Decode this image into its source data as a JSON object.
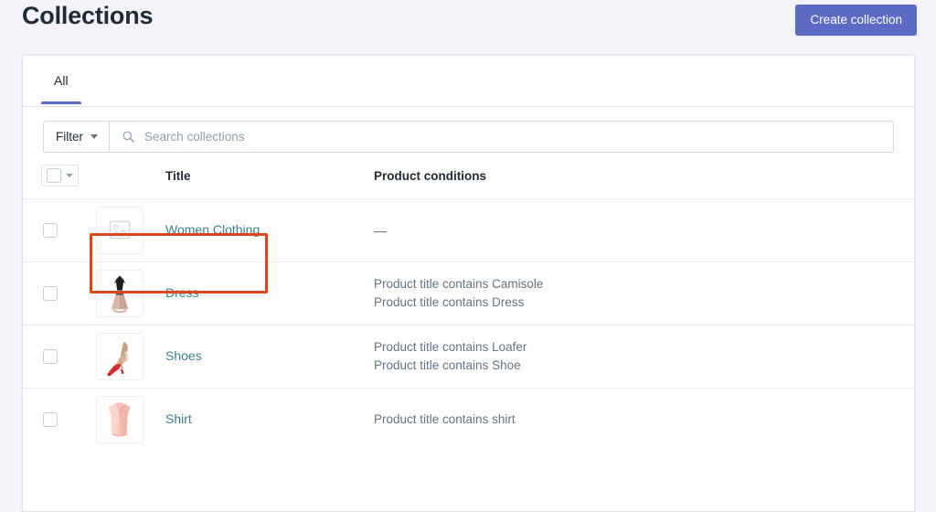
{
  "header": {
    "title": "Collections",
    "create_button_label": "Create collection"
  },
  "card": {
    "tabs": [
      {
        "label": "All",
        "active": true
      }
    ],
    "filter": {
      "button_label": "Filter",
      "caret_icon": "chevron-down-icon"
    },
    "search": {
      "placeholder": "Search collections",
      "value": "",
      "icon": "search-icon"
    },
    "table": {
      "columns": {
        "select": "",
        "thumb": "",
        "title": "Title",
        "conditions": "Product conditions"
      },
      "bulk_select": {
        "checkbox_checked": false,
        "caret_icon": "chevron-down-icon"
      },
      "rows": [
        {
          "title": "Women Clothing",
          "thumb": "image-placeholder-icon",
          "conditions": [
            "—"
          ],
          "highlighted": true
        },
        {
          "title": "Dress",
          "thumb": "dress-thumbnail",
          "conditions": [
            "Product title contains Camisole",
            "Product title contains Dress"
          ],
          "highlighted": false
        },
        {
          "title": "Shoes",
          "thumb": "shoe-thumbnail",
          "conditions": [
            "Product title contains Loafer",
            "Product title contains Shoe"
          ],
          "highlighted": false
        },
        {
          "title": "Shirt",
          "thumb": "shirt-thumbnail",
          "conditions": [
            "Product title contains shirt"
          ],
          "highlighted": false
        }
      ]
    }
  },
  "colors": {
    "page_background": "#f4f3f9",
    "accent": "#5c6ac4",
    "link": "#3f7e8c",
    "highlight_border": "#d9471e",
    "text": "#212b36",
    "muted_text": "#637381"
  }
}
